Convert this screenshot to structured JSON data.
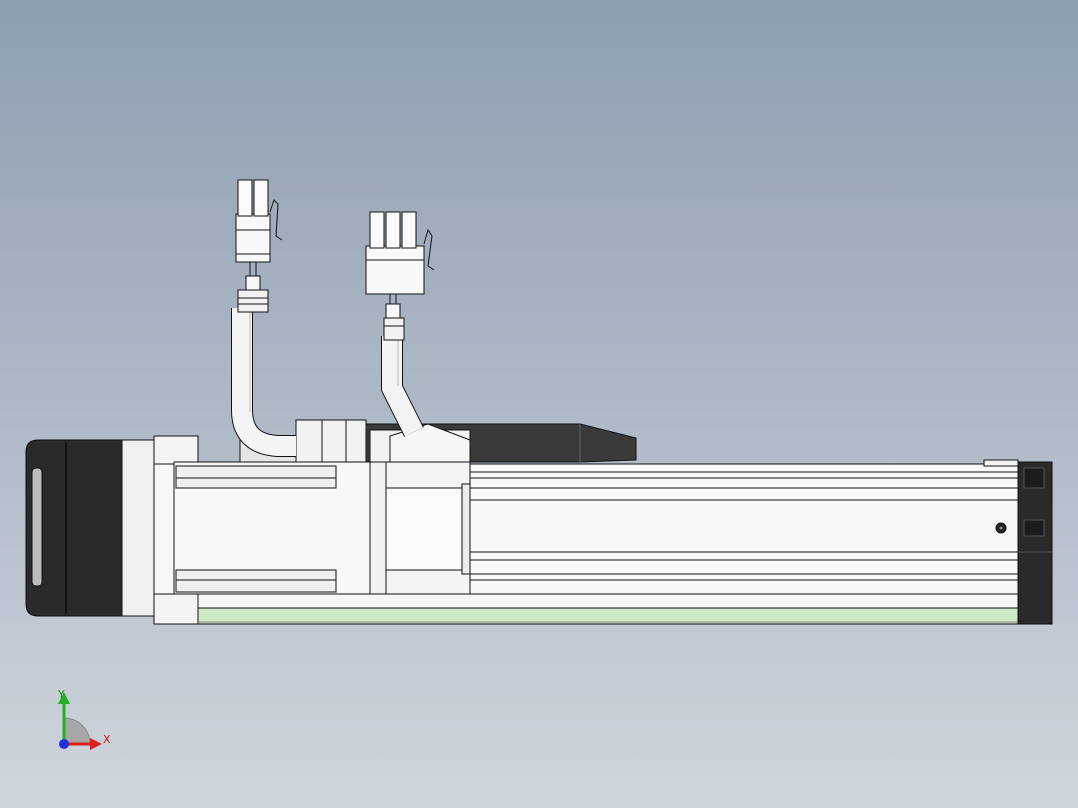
{
  "triad": {
    "x_label": "X",
    "y_label": "Y",
    "colors": {
      "x": "#e02020",
      "y": "#20b020",
      "z": "#2030e0"
    }
  },
  "model": {
    "colors": {
      "housing": "#f4f4f4",
      "end_cap": "#2a2a2a",
      "slider": "#cfe9c8",
      "outline": "#111111",
      "background_top": "#8d9eb2",
      "background_bottom": "#cfd5dc"
    }
  }
}
